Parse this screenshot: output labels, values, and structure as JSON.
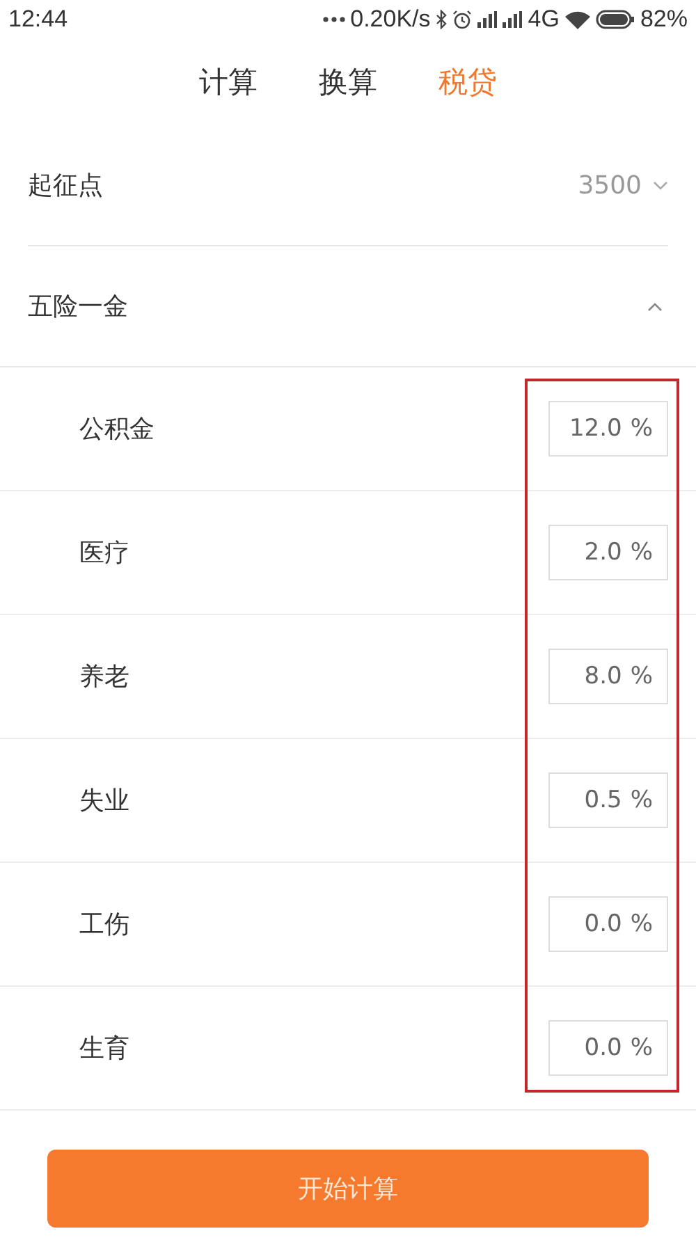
{
  "status_bar": {
    "time": "12:44",
    "net_speed": "0.20K/s",
    "network": "4G",
    "battery": "82%"
  },
  "tabs": [
    {
      "label": "计算",
      "selected": false
    },
    {
      "label": "换算",
      "selected": false
    },
    {
      "label": "税贷",
      "selected": true
    }
  ],
  "threshold": {
    "label": "起征点",
    "value": "3500"
  },
  "insurance": {
    "label": "五险一金",
    "expanded": true,
    "items": [
      {
        "label": "公积金",
        "value": "12.0",
        "unit": "%"
      },
      {
        "label": "医疗",
        "value": "2.0",
        "unit": "%"
      },
      {
        "label": "养老",
        "value": "8.0",
        "unit": "%"
      },
      {
        "label": "失业",
        "value": "0.5",
        "unit": "%"
      },
      {
        "label": "工伤",
        "value": "0.0",
        "unit": "%"
      },
      {
        "label": "生育",
        "value": "0.0",
        "unit": "%"
      }
    ]
  },
  "button": "开始计算"
}
